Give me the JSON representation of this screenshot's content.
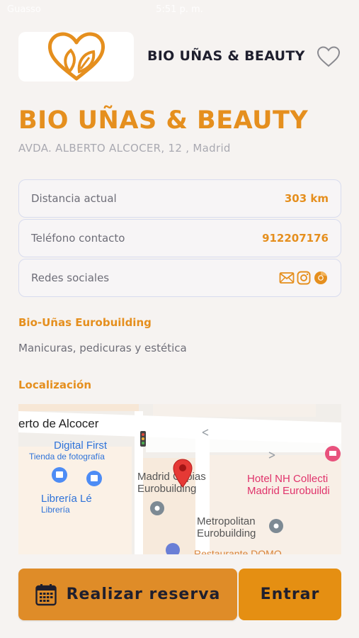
{
  "status_bar": {
    "carrier": "Guasso",
    "time": "5:51 p. m.",
    "right": ""
  },
  "header": {
    "business_name": "BIO UÑAS & BEAUTY"
  },
  "business": {
    "title": "BIO UÑAS & BEAUTY",
    "address": "AVDA. ALBERTO ALCOCER, 12 , Madrid"
  },
  "info": {
    "distance_label": "Distancia actual",
    "distance_value": "303 km",
    "phone_label": "Teléfono contacto",
    "phone_value": "912207176",
    "social_label": "Redes sociales"
  },
  "center": {
    "name": "Bio-Uñas Eurobuilding",
    "description": "Manicuras, pedicuras y estética"
  },
  "location": {
    "title": "Localización"
  },
  "map": {
    "street": "erto de Alcocer",
    "place1_name": "Digital First",
    "place1_type": "Tienda de fotografía",
    "place2_name": "Librería Lé",
    "place2_type": "Librería",
    "place3_line1": "Madrid Copias",
    "place3_line2": "Eurobuilding",
    "hotel_line1": "Hotel NH Collecti",
    "hotel_line2": "Madrid Eurobuildi",
    "metro_line1": "Metropolitan",
    "metro_line2": "Eurobuilding",
    "restaurant": "Restaurante DOMO"
  },
  "actions": {
    "reserve_label": "Realizar reserva",
    "enter_label": "Entrar"
  },
  "colors": {
    "accent": "#e58f1e",
    "button_reserve": "#df8c28",
    "button_enter": "#e58f12",
    "background": "#f6f3f1"
  },
  "icons": [
    "heart-logo-icon",
    "favorite-heart-icon",
    "email-icon",
    "instagram-icon",
    "web-icon",
    "calendar-icon",
    "map-pin-icon"
  ]
}
